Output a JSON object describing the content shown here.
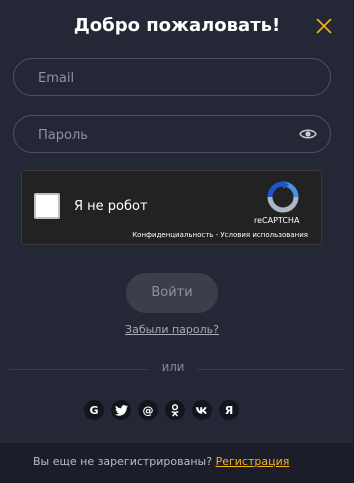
{
  "modal": {
    "title": "Добро пожаловать!",
    "close_icon": "close-icon",
    "accent_color": "#f4b41a"
  },
  "form": {
    "email_placeholder": "Email",
    "password_placeholder": "Пароль",
    "eye_icon": "eye-icon"
  },
  "captcha": {
    "label": "Я не робот",
    "brand": "reCAPTCHA",
    "privacy": "Конфиденциальность",
    "separator": " - ",
    "terms": "Условия использования"
  },
  "login_label": "Войти",
  "forgot_label": "Забыли пароль?",
  "or_label": "ИЛИ",
  "socials": [
    {
      "name": "google",
      "glyph": "G"
    },
    {
      "name": "twitter",
      "glyph": "🐦"
    },
    {
      "name": "mailru",
      "glyph": "@"
    },
    {
      "name": "odnoklassniki",
      "glyph": "ок"
    },
    {
      "name": "vk",
      "glyph": "vk"
    },
    {
      "name": "yandex",
      "glyph": "Я"
    }
  ],
  "footer": {
    "text": "Вы еще не зарегистрированы?",
    "link": "Регистрация"
  }
}
